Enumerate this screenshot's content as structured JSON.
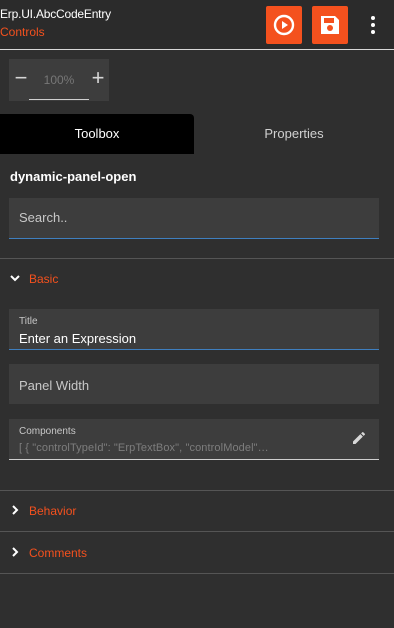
{
  "header": {
    "title": "Erp.UI.AbcCodeEntry",
    "subtitle": "Controls",
    "run_icon": "play-circle-icon",
    "save_icon": "save-icon",
    "menu_icon": "more-vertical-icon",
    "accent": "#f4511e"
  },
  "zoom": {
    "minus": "−",
    "plus": "+",
    "value": "100%"
  },
  "tabs": [
    {
      "label": "Toolbox",
      "active": true
    },
    {
      "label": "Properties",
      "active": false
    }
  ],
  "panel": {
    "name": "dynamic-panel-open",
    "search_placeholder": "Search.."
  },
  "sections": {
    "basic": "Basic",
    "behavior": "Behavior",
    "comments": "Comments"
  },
  "fields": {
    "title_label": "Title",
    "title_value": "Enter an Expression",
    "panel_width_label": "Panel Width",
    "components_label": "Components",
    "components_value": "[ {   \"controlTypeId\": \"ErpTextBox\",   \"controlModel\"…",
    "edit_icon": "pencil-icon"
  }
}
